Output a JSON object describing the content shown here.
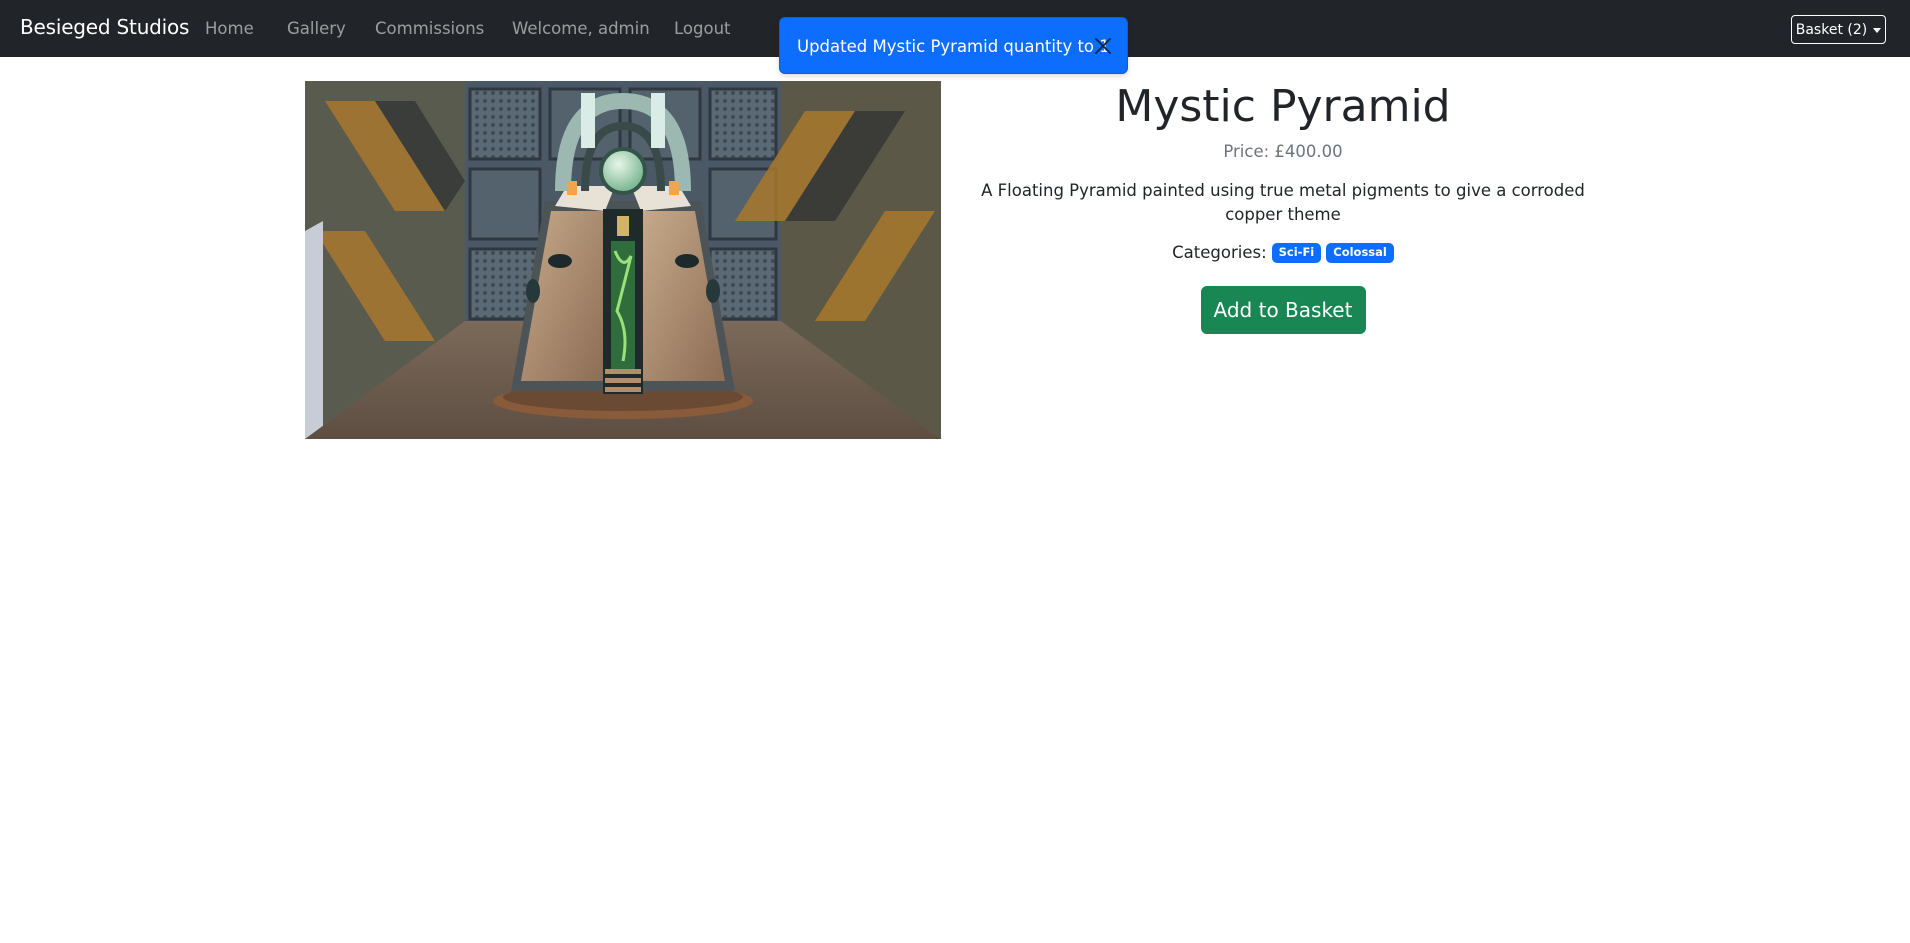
{
  "navbar": {
    "brand": "Besieged Studios",
    "links": [
      "Home",
      "Gallery",
      "Commissions",
      "Welcome, admin",
      "Logout"
    ],
    "basket_label": "Basket (2)"
  },
  "toast": {
    "message": "Updated Mystic Pyramid quantity to 1"
  },
  "product": {
    "title": "Mystic Pyramid",
    "price": "Price: £400.00",
    "description": "A Floating Pyramid painted using true metal pigments to give a corroded copper theme",
    "categories_label": "Categories:",
    "categories": [
      "Sci-Fi",
      "Colossal"
    ],
    "add_button": "Add to Basket"
  },
  "colors": {
    "navbar": "#212529",
    "toast": "#0d6efd",
    "badge": "#0d6efd",
    "add_button": "#198754"
  }
}
